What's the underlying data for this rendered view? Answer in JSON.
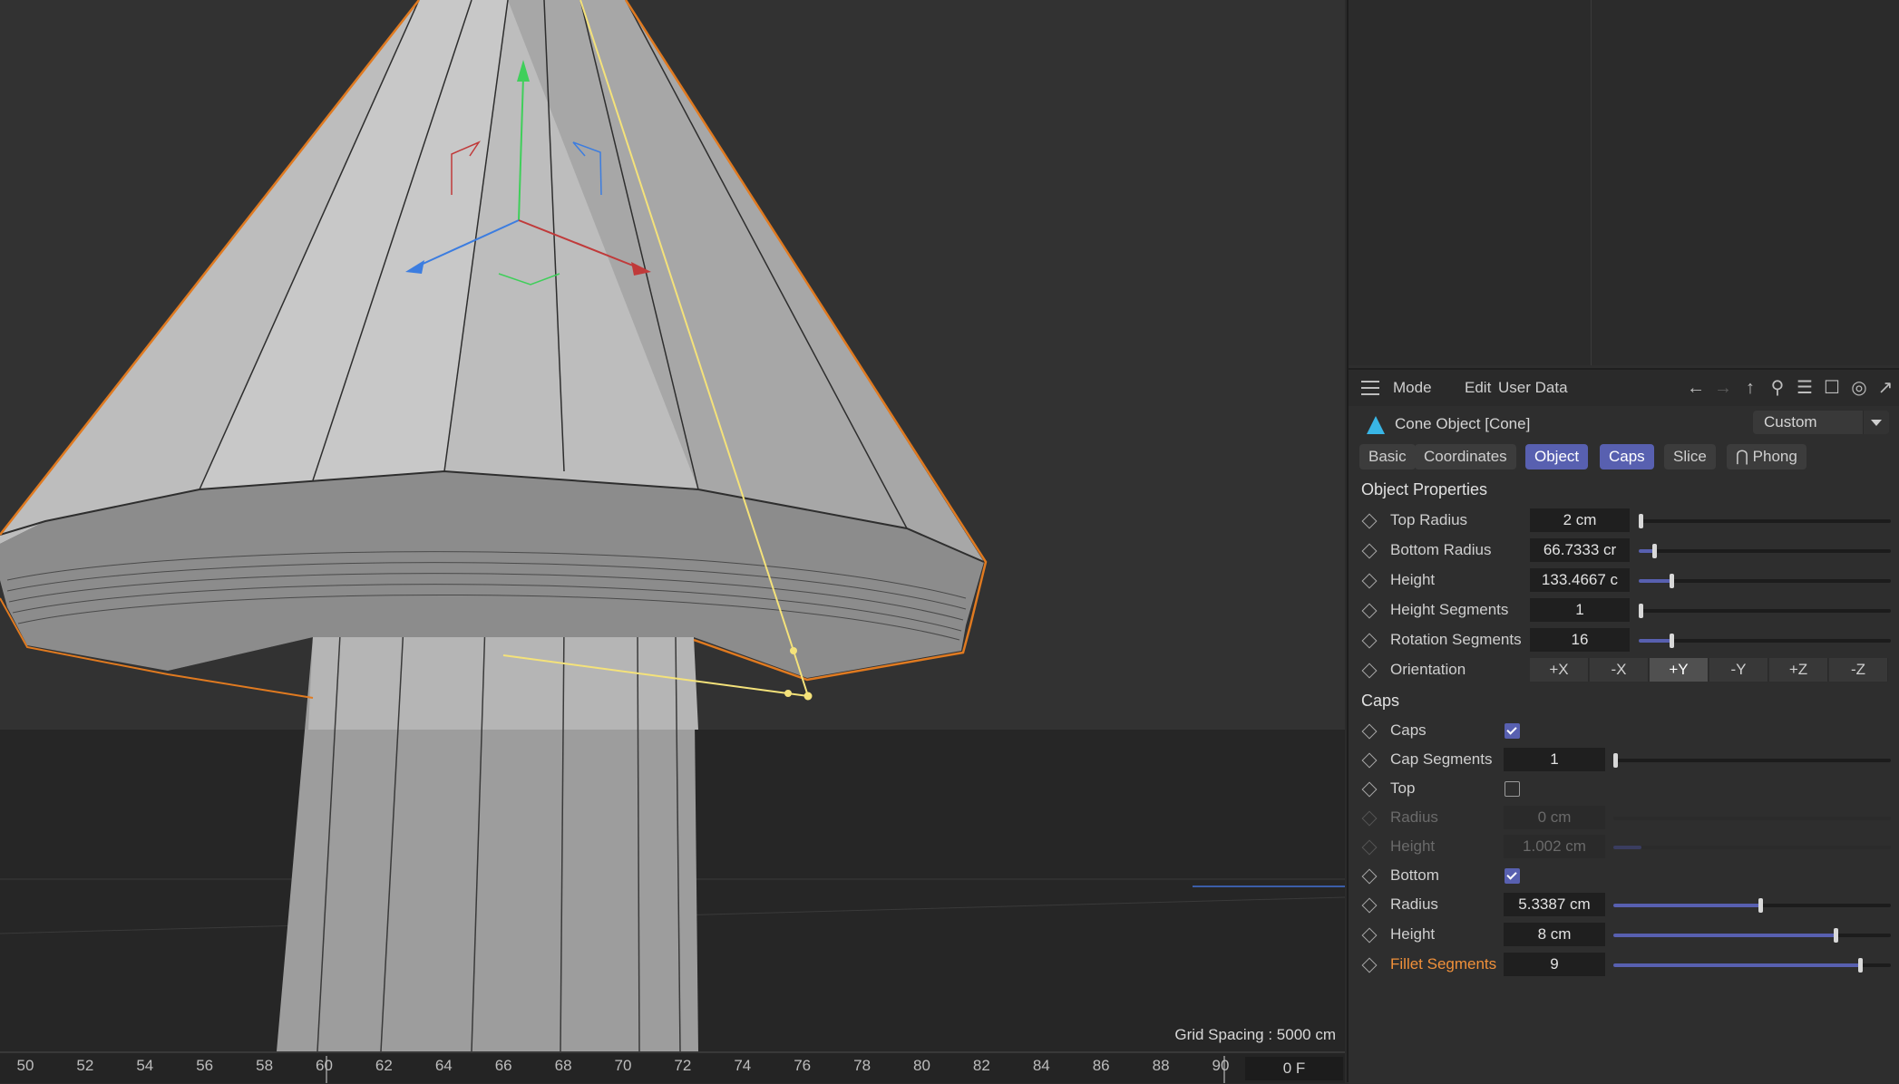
{
  "viewport": {
    "grid_spacing": "Grid Spacing : 5000 cm"
  },
  "timeline": {
    "ticks": [
      "50",
      "52",
      "54",
      "56",
      "58",
      "60",
      "62",
      "64",
      "66",
      "68",
      "70",
      "72",
      "74",
      "76",
      "78",
      "80",
      "82",
      "84",
      "86",
      "88",
      "90"
    ],
    "current_frame": "0 F"
  },
  "attributes": {
    "menu": {
      "mode": "Mode",
      "edit": "Edit",
      "user_data": "User Data"
    },
    "title": "Cone Object [Cone]",
    "layout_dropdown": "Custom",
    "tabs": {
      "basic": "Basic",
      "coordinates": "Coordinates",
      "object": "Object",
      "caps": "Caps",
      "slice": "Slice",
      "phong": "Phong"
    },
    "object_properties": {
      "heading": "Object Properties",
      "top_radius": {
        "label": "Top Radius",
        "value": "2 cm",
        "level": 0.0
      },
      "bottom_radius": {
        "label": "Bottom Radius",
        "value": "66.7333 cr",
        "level": 0.06
      },
      "height": {
        "label": "Height",
        "value": "133.4667 c",
        "level": 0.13
      },
      "height_segments": {
        "label": "Height Segments",
        "value": "1",
        "level": 0.0
      },
      "rotation_segments": {
        "label": "Rotation Segments",
        "value": "16",
        "level": 0.13
      },
      "orientation": {
        "label": "Orientation",
        "options": [
          "+X",
          "-X",
          "+Y",
          "-Y",
          "+Z",
          "-Z"
        ],
        "selected": "+Y"
      }
    },
    "caps": {
      "heading": "Caps",
      "caps": {
        "label": "Caps",
        "checked": true
      },
      "cap_segments": {
        "label": "Cap Segments",
        "value": "1",
        "level": 0.0
      },
      "top": {
        "label": "Top",
        "checked": false
      },
      "top_radius": {
        "label": "Radius",
        "value": "0 cm",
        "level": 0.0
      },
      "top_height": {
        "label": "Height",
        "value": "1.002 cm",
        "level": 0.1
      },
      "bottom": {
        "label": "Bottom",
        "checked": true
      },
      "bottom_radius": {
        "label": "Radius",
        "value": "5.3387 cm",
        "level": 0.53
      },
      "bottom_height": {
        "label": "Height",
        "value": "8 cm",
        "level": 0.8
      },
      "fillet_segments": {
        "label": "Fillet Segments",
        "value": "9",
        "level": 0.89
      }
    }
  },
  "colors": {
    "accent": "#5860b0",
    "selection_outline": "#e07a20",
    "handle_line": "#f4e27a",
    "highlight_label": "#f0903a"
  }
}
